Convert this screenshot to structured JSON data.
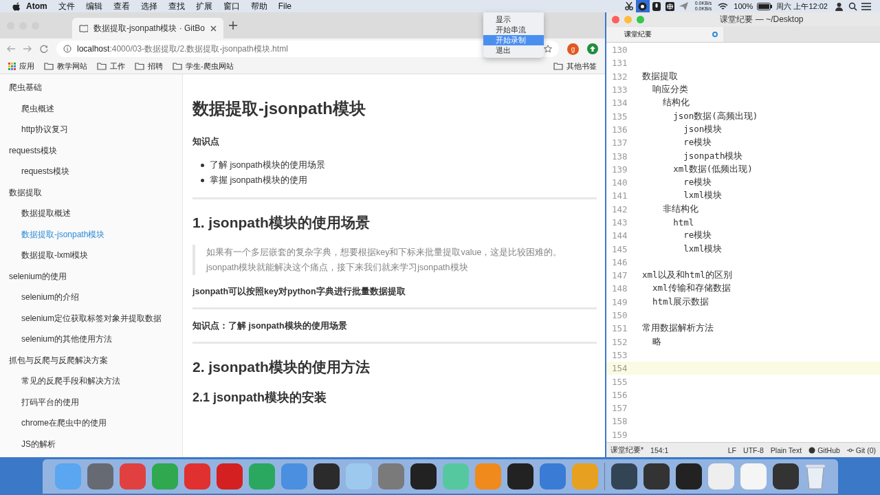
{
  "menubar": {
    "app": "Atom",
    "menus": [
      "文件",
      "编辑",
      "查看",
      "选择",
      "查找",
      "扩展",
      "窗口",
      "帮助",
      "File"
    ],
    "net_up": "0.0KB/s",
    "net_down": "0.0KB/s",
    "battery": "100%",
    "clock": "周六 上午12:02"
  },
  "status_menu": {
    "items": [
      {
        "label": "显示",
        "selected": false
      },
      {
        "label": "开始串流",
        "selected": false
      },
      {
        "label": "开始录制",
        "selected": true
      },
      {
        "label": "退出",
        "selected": false
      }
    ]
  },
  "browser": {
    "tab": {
      "title": "数据提取-jsonpath模块 · GitBo"
    },
    "url_host": "localhost",
    "url_path": ":4000/03-数据提取/2.数据提取-jsonpath模块.html",
    "profile": "g",
    "bookmarks": [
      {
        "kind": "apps",
        "label": "应用"
      },
      {
        "kind": "folder",
        "label": "教学网站"
      },
      {
        "kind": "folder",
        "label": "工作"
      },
      {
        "kind": "folder",
        "label": "招聘"
      },
      {
        "kind": "folder",
        "label": "学生-爬虫网站"
      }
    ],
    "other_bookmarks": "其他书签",
    "sidebar": [
      {
        "label": "爬虫基础",
        "selected": false,
        "children": [
          {
            "label": "爬虫概述",
            "selected": false
          },
          {
            "label": "http协议复习",
            "selected": false
          }
        ]
      },
      {
        "label": "requests模块",
        "selected": false,
        "children": [
          {
            "label": "requests模块",
            "selected": false
          }
        ]
      },
      {
        "label": "数据提取",
        "selected": false,
        "children": [
          {
            "label": "数据提取概述",
            "selected": false
          },
          {
            "label": "数据提取-jsonpath模块",
            "selected": true
          },
          {
            "label": "数据提取-lxml模块",
            "selected": false
          }
        ]
      },
      {
        "label": "selenium的使用",
        "selected": false,
        "children": [
          {
            "label": "selenium的介绍",
            "selected": false
          },
          {
            "label": "selenium定位获取标签对象并提取数据",
            "selected": false
          },
          {
            "label": "selenium的其他使用方法",
            "selected": false
          }
        ]
      },
      {
        "label": "抓包与反爬与反爬解决方案",
        "selected": false,
        "children": [
          {
            "label": "常见的反爬手段和解决方法",
            "selected": false
          },
          {
            "label": "打码平台的使用",
            "selected": false
          },
          {
            "label": "chrome在爬虫中的使用",
            "selected": false
          },
          {
            "label": "JS的解析",
            "selected": false
          }
        ]
      }
    ],
    "article": [
      {
        "kind": "h1",
        "text": "数据提取-jsonpath模块"
      },
      {
        "kind": "strong",
        "text": "知识点"
      },
      {
        "kind": "bullets",
        "items": [
          "了解 jsonpath模块的使用场景",
          "掌握 jsonpath模块的使用"
        ]
      },
      {
        "kind": "rule"
      },
      {
        "kind": "h2",
        "text": "1. jsonpath模块的使用场景"
      },
      {
        "kind": "quote",
        "text": "如果有一个多层嵌套的复杂字典，想要根据key和下标来批量提取value，这是比较困难的。jsonpath模块就能解决这个痛点，接下来我们就来学习jsonpath模块"
      },
      {
        "kind": "strong",
        "text": "jsonpath可以按照key对python字典进行批量数据提取"
      },
      {
        "kind": "rule"
      },
      {
        "kind": "strong",
        "text": "知识点：了解 jsonpath模块的使用场景"
      },
      {
        "kind": "rule"
      },
      {
        "kind": "h2",
        "text": "2. jsonpath模块的使用方法"
      },
      {
        "kind": "h3",
        "text": "2.1 jsonpath模块的安装"
      }
    ]
  },
  "editor": {
    "title": "课堂纪要 — ~/Desktop",
    "tab": {
      "title": "课堂纪要",
      "modified": true
    },
    "lines": [
      {
        "number": "130",
        "current": false
      },
      {
        "number": "131",
        "current": false
      },
      {
        "number": "132",
        "text": "数据提取",
        "current": false
      },
      {
        "number": "133",
        "text": "  响应分类",
        "current": false
      },
      {
        "number": "134",
        "text": "    结构化",
        "current": false
      },
      {
        "number": "135",
        "text": "      json数据(高频出现)",
        "current": false
      },
      {
        "number": "136",
        "text": "        json模块",
        "current": false
      },
      {
        "number": "137",
        "text": "        re模块",
        "current": false
      },
      {
        "number": "138",
        "text": "        jsonpath模块",
        "current": false
      },
      {
        "number": "139",
        "text": "      xml数据(低频出现)",
        "current": false
      },
      {
        "number": "140",
        "text": "        re模块",
        "current": false
      },
      {
        "number": "141",
        "text": "        lxml模块",
        "current": false
      },
      {
        "number": "142",
        "text": "    非结构化",
        "current": false
      },
      {
        "number": "143",
        "text": "      html",
        "current": false
      },
      {
        "number": "144",
        "text": "        re模块",
        "current": false
      },
      {
        "number": "145",
        "text": "        lxml模块",
        "current": false
      },
      {
        "number": "146",
        "current": false
      },
      {
        "number": "147",
        "text": "xml以及和html的区别",
        "current": false
      },
      {
        "number": "148",
        "text": "  xml传输和存储数据",
        "current": false
      },
      {
        "number": "149",
        "text": "  html展示数据",
        "current": false
      },
      {
        "number": "150",
        "current": false
      },
      {
        "number": "151",
        "text": "常用数据解析方法",
        "current": false
      },
      {
        "number": "152",
        "text": "  略",
        "current": false
      },
      {
        "number": "153",
        "current": false
      },
      {
        "number": "154",
        "current": true
      },
      {
        "number": "155",
        "current": false
      },
      {
        "number": "156",
        "current": false
      },
      {
        "number": "157",
        "current": false
      },
      {
        "number": "158",
        "current": false
      },
      {
        "number": "159",
        "current": false
      }
    ],
    "status": {
      "file": "课堂纪要*",
      "cursor": "154:1",
      "line_ending": "LF",
      "encoding": "UTF-8",
      "grammar": "Plain Text",
      "github": "GitHub",
      "git": "Git (0)"
    }
  }
}
